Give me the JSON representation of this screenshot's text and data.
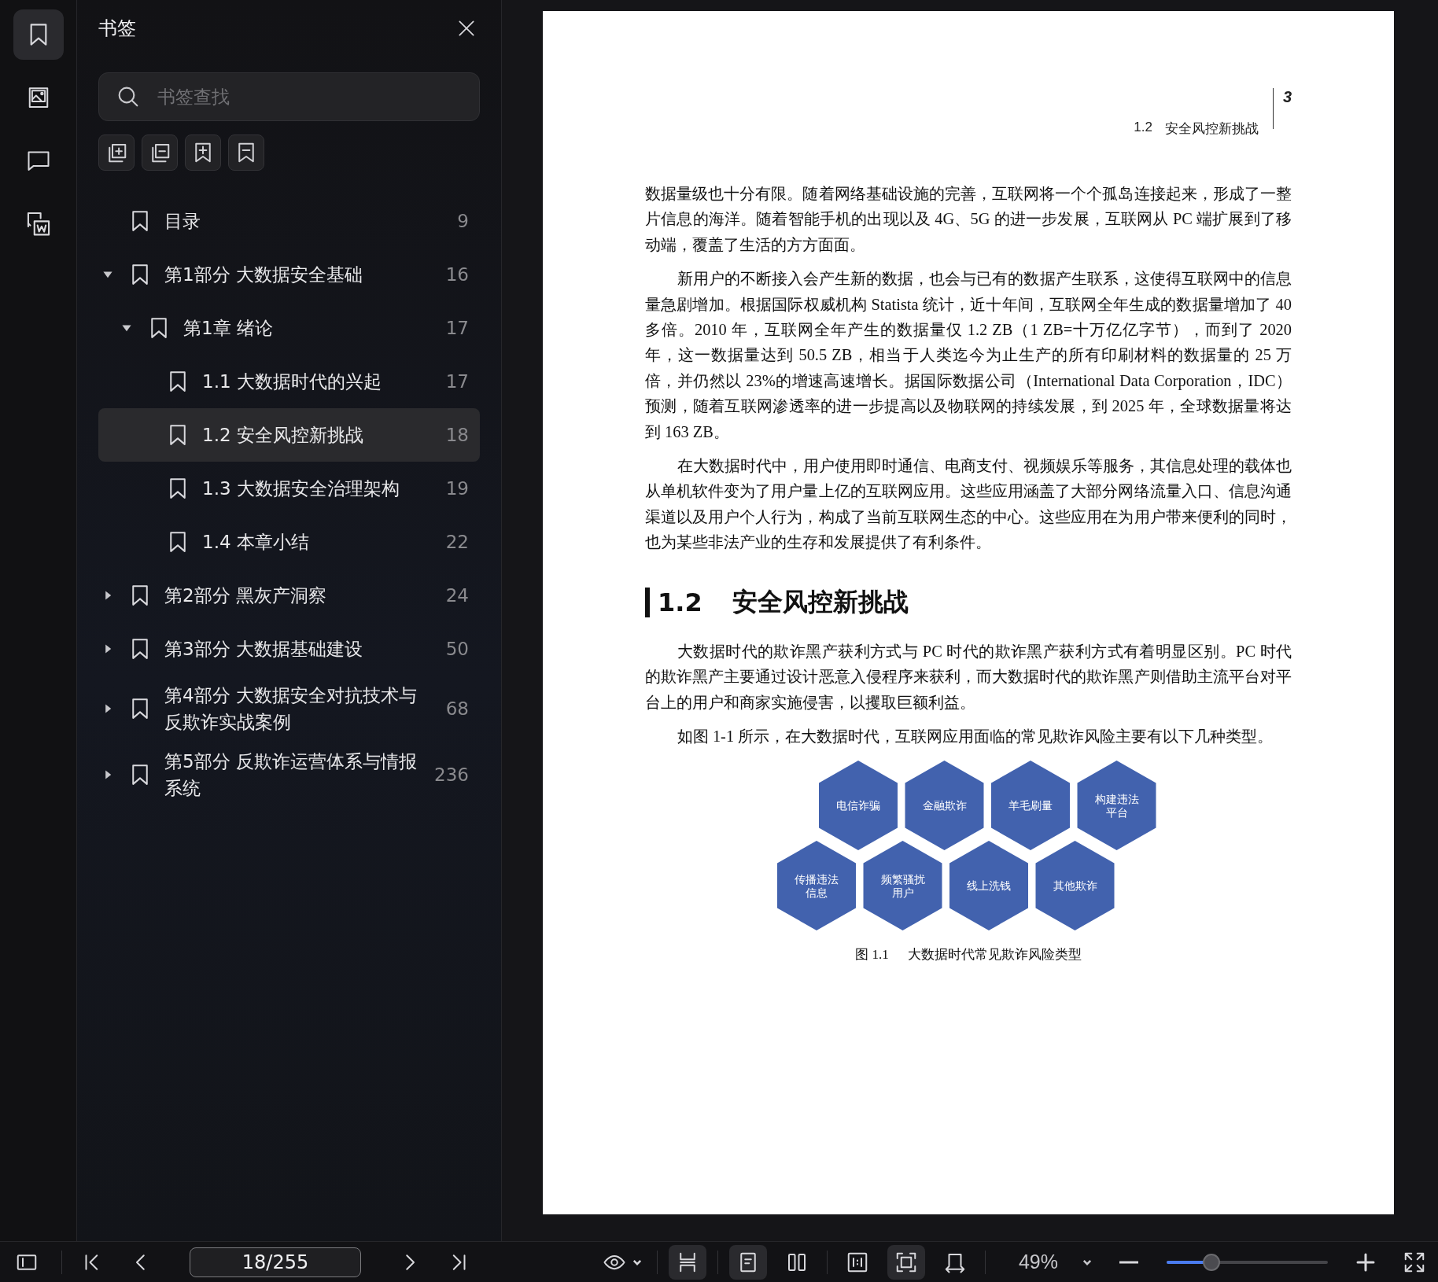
{
  "rail": [
    {
      "selected": true
    },
    {
      "selected": false
    },
    {
      "selected": false
    },
    {
      "selected": false
    }
  ],
  "sidebar": {
    "title": "书签",
    "search": {
      "placeholder": "书签查找"
    },
    "bookmarks": [
      {
        "label": "目录",
        "page": "9",
        "selected": false
      },
      {
        "label": "第1部分 大数据安全基础",
        "page": "16",
        "selected": false,
        "expanded": true,
        "children": [
          {
            "label": "第1章 绪论",
            "page": "17",
            "selected": false,
            "expanded": true,
            "children": [
              {
                "label": "1.1 大数据时代的兴起",
                "page": "17",
                "selected": false
              },
              {
                "label": "1.2 安全风控新挑战",
                "page": "18",
                "selected": true
              },
              {
                "label": "1.3 大数据安全治理架构",
                "page": "19",
                "selected": false
              },
              {
                "label": "1.4 本章小结",
                "page": "22",
                "selected": false
              }
            ]
          }
        ]
      },
      {
        "label": "第2部分 黑灰产洞察",
        "page": "24",
        "selected": false,
        "expanded": false
      },
      {
        "label": "第3部分 大数据基础建设",
        "page": "50",
        "selected": false,
        "expanded": false
      },
      {
        "label": "第4部分 大数据安全对抗技术与反欺诈实战案例",
        "page": "68",
        "selected": false,
        "expanded": false
      },
      {
        "label": "第5部分 反欺诈运营体系与情报系统",
        "page": "236",
        "selected": false,
        "expanded": false
      }
    ]
  },
  "page": {
    "running_head": {
      "number": "1.2",
      "title": "安全风控新挑战"
    },
    "page_number": "3",
    "blocks": [
      {
        "kind": "paragraph",
        "indent": false,
        "text": "数据量级也十分有限。随着网络基础设施的完善，互联网将一个个孤岛连接起来，形成了一整片信息的海洋。随着智能手机的出现以及 4G、5G 的进一步发展，互联网从 PC 端扩展到了移动端，覆盖了生活的方方面面。"
      },
      {
        "kind": "paragraph",
        "indent": true,
        "text": "新用户的不断接入会产生新的数据，也会与已有的数据产生联系，这使得互联网中的信息量急剧增加。根据国际权威机构 Statista 统计，近十年间，互联网全年生成的数据量增加了 40 多倍。2010 年，互联网全年产生的数据量仅 1.2 ZB（1 ZB=十万亿亿字节），而到了 2020 年，这一数据量达到 50.5 ZB，相当于人类迄今为止生产的所有印刷材料的数据量的 25 万倍，并仍然以 23%的增速高速增长。据国际数据公司（International Data Corporation，IDC）预测，随着互联网渗透率的进一步提高以及物联网的持续发展，到 2025 年，全球数据量将达到 163 ZB。"
      },
      {
        "kind": "paragraph",
        "indent": true,
        "text": "在大数据时代中，用户使用即时通信、电商支付、视频娱乐等服务，其信息处理的载体也从单机软件变为了用户量上亿的互联网应用。这些应用涵盖了大部分网络流量入口、信息沟通渠道以及用户个人行为，构成了当前互联网生态的中心。这些应用在为用户带来便利的同时，也为某些非法产业的生存和发展提供了有利条件。"
      },
      {
        "kind": "heading",
        "number": "1.2",
        "text": "安全风控新挑战"
      },
      {
        "kind": "paragraph",
        "indent": true,
        "text": "大数据时代的欺诈黑产获利方式与 PC 时代的欺诈黑产获利方式有着明显区别。PC 时代的欺诈黑产主要通过设计恶意入侵程序来获利，而大数据时代的欺诈黑产则借助主流平台对平台上的用户和商家实施侵害，以攫取巨额利益。"
      },
      {
        "kind": "paragraph",
        "indent": true,
        "text": "如图 1-1 所示，在大数据时代，互联网应用面临的常见欺诈风险主要有以下几种类型。"
      },
      {
        "kind": "figure",
        "rows": [
          [
            {
              "lines": [
                "电信诈骗"
              ]
            },
            {
              "lines": [
                "金融欺诈"
              ]
            },
            {
              "lines": [
                "羊毛刷量"
              ]
            },
            {
              "lines": [
                "构建违法",
                "平台"
              ]
            }
          ],
          [
            {
              "lines": [
                "传播违法",
                "信息"
              ]
            },
            {
              "lines": [
                "频繁骚扰",
                "用户"
              ]
            },
            {
              "lines": [
                "线上洗钱"
              ]
            },
            {
              "lines": [
                "其他欺诈"
              ]
            }
          ]
        ],
        "caption": {
          "number": "图 1.1",
          "text": "大数据时代常见欺诈风险类型"
        }
      }
    ]
  },
  "toolbar": {
    "page_field": {
      "value": "18/255"
    },
    "view_modes": [
      {
        "selected": true
      },
      {
        "selected": true
      },
      {
        "selected": false
      },
      {
        "selected": false
      },
      {
        "selected": true
      },
      {
        "selected": false
      }
    ],
    "zoom": {
      "value": "49%",
      "level": 0.28
    }
  }
}
